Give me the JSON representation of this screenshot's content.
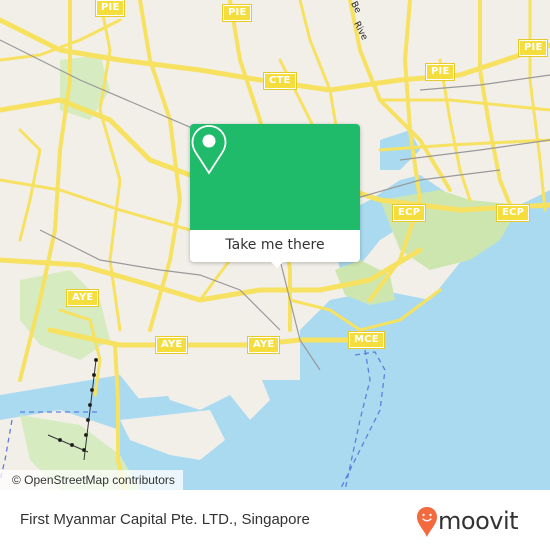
{
  "map": {
    "popup": {
      "icon": "map-pin-icon",
      "button_label": "Take me there",
      "accent_color": "#1fba6a"
    },
    "attribution": "© OpenStreetMap contributors",
    "road_labels": [
      {
        "id": "pie-1",
        "text": "PIE"
      },
      {
        "id": "pie-2",
        "text": "PIE"
      },
      {
        "id": "pie-3",
        "text": "PIE"
      },
      {
        "id": "pie-4",
        "text": "PIE"
      },
      {
        "id": "cte",
        "text": "CTE"
      },
      {
        "id": "ecp-1",
        "text": "ECP"
      },
      {
        "id": "ecp-2",
        "text": "ECP"
      },
      {
        "id": "aye-1",
        "text": "AYE"
      },
      {
        "id": "aye-2",
        "text": "AYE"
      },
      {
        "id": "aye-3",
        "text": "AYE"
      },
      {
        "id": "mce",
        "text": "MCE"
      }
    ],
    "street_names": [
      {
        "id": "river",
        "text": "Rive"
      },
      {
        "id": "street-top",
        "text": "Be"
      }
    ],
    "colors": {
      "land": "#f2efe9",
      "water": "#aadaf0",
      "park": "#cde6b0",
      "road": "#f7e160"
    }
  },
  "footer": {
    "place_name": "First Myanmar Capital Pte. LTD., Singapore",
    "brand": "moovit",
    "brand_color": "#f26a3d"
  }
}
